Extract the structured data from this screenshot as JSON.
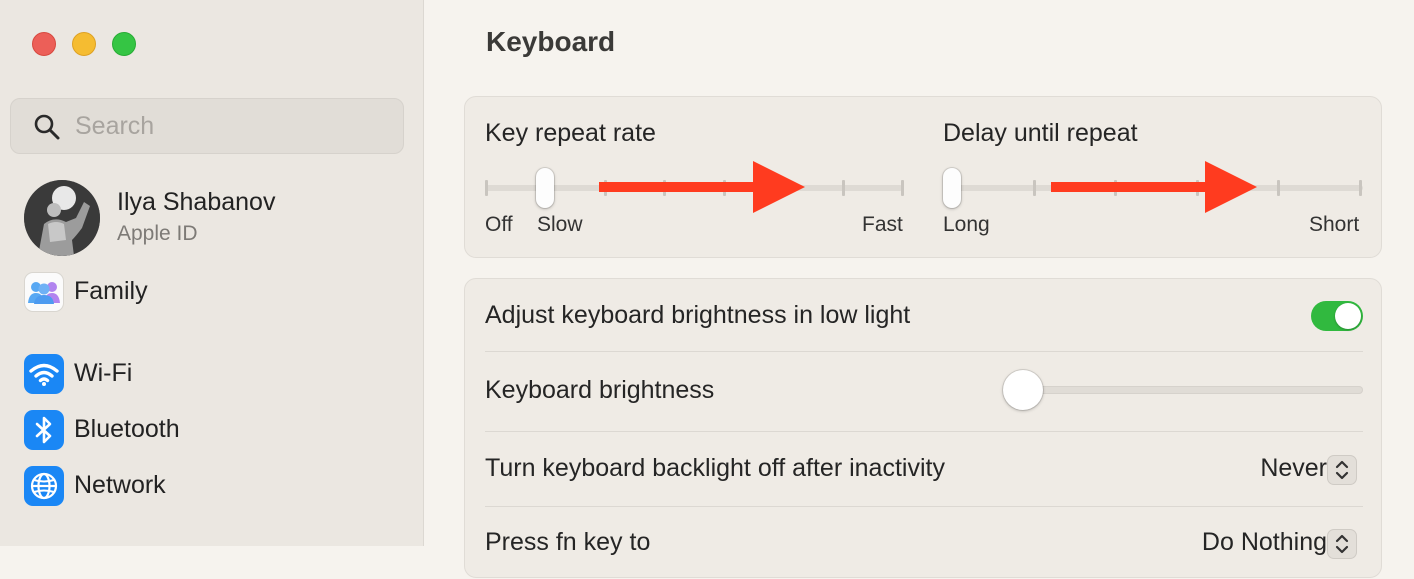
{
  "window": {
    "close_button": "close",
    "minimize_button": "minimize",
    "zoom_button": "zoom"
  },
  "sidebar": {
    "search": {
      "placeholder": "Search",
      "value": "",
      "icon": "search-icon"
    },
    "profile": {
      "name": "Ilya Shabanov",
      "subtitle": "Apple ID"
    },
    "items": [
      {
        "label": "Family",
        "icon": "family-icon"
      },
      {
        "label": "Wi-Fi",
        "icon": "wifi-icon"
      },
      {
        "label": "Bluetooth",
        "icon": "bluetooth-icon"
      },
      {
        "label": "Network",
        "icon": "network-icon"
      }
    ]
  },
  "main": {
    "title": "Keyboard",
    "key_repeat": {
      "title": "Key repeat rate",
      "labels": {
        "off": "Off",
        "slow": "Slow",
        "fast": "Fast"
      },
      "steps": 8,
      "value_step": 1
    },
    "delay_repeat": {
      "title": "Delay until repeat",
      "labels": {
        "long": "Long",
        "short": "Short"
      },
      "steps": 6,
      "value_step": 0
    },
    "annotations": {
      "arrow_color": "#ff3b1f"
    },
    "settings": {
      "adjust_brightness": {
        "label": "Adjust keyboard brightness in low light",
        "enabled": true
      },
      "keyboard_brightness": {
        "label": "Keyboard brightness",
        "value_fraction": 0.0
      },
      "backlight_off": {
        "label": "Turn keyboard backlight off after inactivity",
        "value": "Never"
      },
      "fn_key": {
        "label": "Press fn key to",
        "value": "Do Nothing"
      }
    }
  },
  "colors": {
    "accent_blue": "#1a87f5",
    "toggle_green": "#31b93f",
    "close_red": "#ec5f58",
    "minimize_yellow": "#f5bc31",
    "zoom_green": "#35c544"
  }
}
